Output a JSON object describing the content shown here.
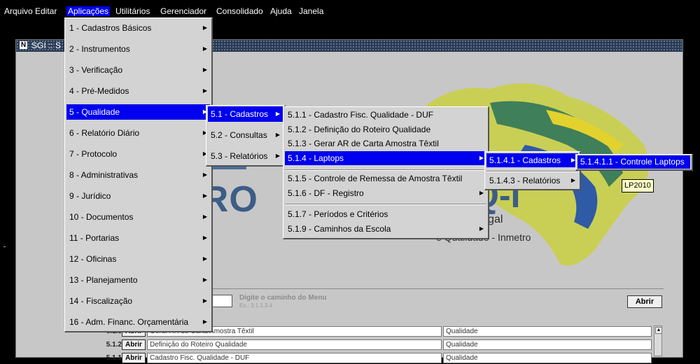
{
  "menubar": [
    "Arquivo",
    "Editar",
    "Aplicações",
    "Utilitários",
    "Gerenciador",
    "Consolidado",
    "Ajuda",
    "Janela"
  ],
  "window": {
    "title": "SGI :: S"
  },
  "logo": {
    "text_tro": "TRO",
    "text_legal": "logia Legal",
    "text_quality": "e Qualidade - Inmetro",
    "text_q1": "Q-I"
  },
  "search": {
    "hint": "Digite o caminho do Menu",
    "example": "Ex.: 3.1.1.3.4",
    "abrir": "Abrir"
  },
  "rows": [
    {
      "code": "5.1.3",
      "button": "Abrir",
      "desc": "Gerar AR de Carta Amostra Têxtil",
      "cat": "Qualidade"
    },
    {
      "code": "5.1.2",
      "button": "Abrir",
      "desc": "Definição do Roteiro Qualidade",
      "cat": "Qualidade"
    },
    {
      "code": "5.1.1",
      "button": "Abrir",
      "desc": "Cadastro Fisc. Qualidade - DUF",
      "cat": "Qualidade"
    }
  ],
  "menu_aplicacoes": [
    "1 - Cadastros Básicos",
    "2 - Instrumentos",
    "3 - Verificação",
    "4 - Pré-Medidos",
    "5 - Qualidade",
    "6 - Relatório Diário",
    "7 - Protocolo",
    "8 - Administrativas",
    "9 - Jurídico",
    "10 - Documentos",
    "11 - Portarias",
    "12 - Oficinas",
    "13 - Planejamento",
    "14 - Fiscalização",
    "16 - Adm. Financ. Orçamentária"
  ],
  "menu_qualidade": [
    "5.1 - Cadastros",
    "5.2 - Consultas",
    "5.3 - Relatórios"
  ],
  "menu_cadastros": [
    "5.1.1 - Cadastro Fisc. Qualidade - DUF",
    "5.1.2 - Definição do Roteiro Qualidade",
    "5.1.3 - Gerar AR de Carta Amostra Têxtil",
    "5.1.4 - Laptops",
    "5.1.5 - Controle de Remessa de Amostra Têxtil",
    "5.1.6 - DF - Registro",
    "5.1.7 - Períodos e Critérios",
    "5.1.9 - Caminhos da Escola"
  ],
  "menu_laptops": [
    "5.1.4.1 - Cadastros",
    "5.1.4.3 - Relatórios"
  ],
  "menu_laptops_cad": [
    "5.1.4.1.1 - Controle Laptops"
  ],
  "tooltip": "LP2010",
  "colors": {
    "highlight": "#0000ee",
    "menu_bg": "#d3d3d3",
    "logo_blue": "#3c5d86"
  }
}
